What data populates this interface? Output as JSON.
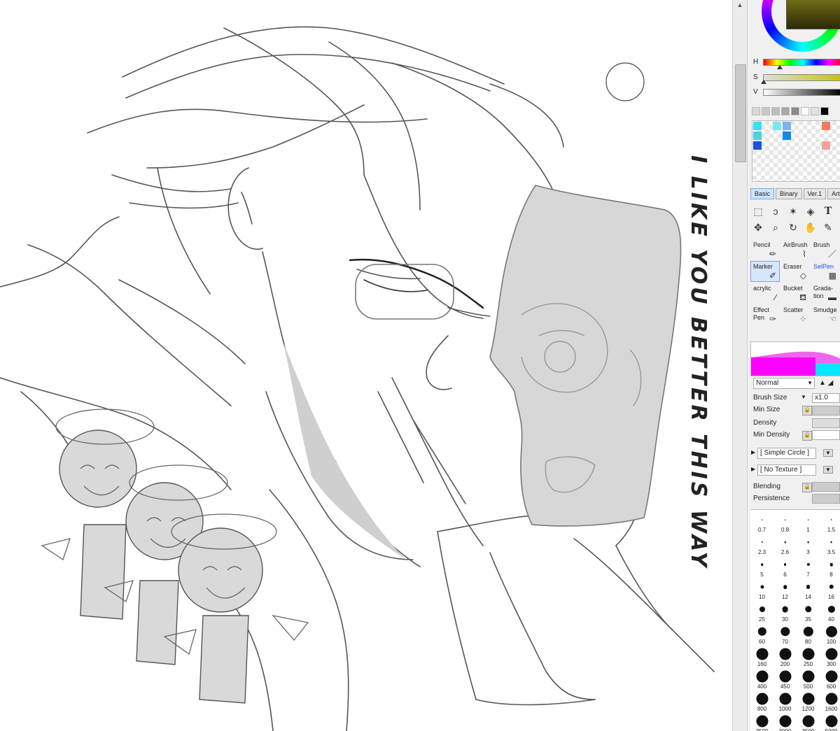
{
  "canvas": {
    "vertical_text": "I LIKE YOU BETTER THIS WAY"
  },
  "panel": {
    "sliders": {
      "h": "H",
      "s": "S",
      "v": "V"
    },
    "tabs": [
      "Basic",
      "Binary",
      "Ver.1",
      "Art"
    ],
    "tools": [
      "select-rect-icon",
      "lasso-icon",
      "magic-wand-icon",
      "layer-select-icon",
      "text-tool-icon",
      "move-icon",
      "zoom-icon",
      "rotate-icon",
      "hand-icon",
      "eyedropper-icon"
    ],
    "brushes": [
      {
        "label": "Pencil",
        "icon": "pencil-icon"
      },
      {
        "label": "AirBrush",
        "icon": "airbrush-icon"
      },
      {
        "label": "Brush",
        "icon": "brush-icon"
      },
      {
        "label": "Marker",
        "icon": "marker-icon",
        "selected": true
      },
      {
        "label": "Eraser",
        "icon": "eraser-icon"
      },
      {
        "label": "SelPen",
        "icon": "selpen-icon"
      },
      {
        "label": "acrylic",
        "icon": "acrylic-icon"
      },
      {
        "label": "Bucket",
        "icon": "bucket-icon"
      },
      {
        "label": "Grada-\ntion",
        "icon": "gradation-icon"
      },
      {
        "label": "Effect\nPen",
        "icon": "effect-pen-icon"
      },
      {
        "label": "Scatter",
        "icon": "scatter-icon"
      },
      {
        "label": "Smudge",
        "icon": "smudge-icon"
      }
    ],
    "blend_mode": "Normal",
    "brush_size_label": "Brush Size",
    "brush_size_value": "x1.0",
    "min_size_label": "Min Size",
    "density_label": "Density",
    "min_density_label": "Min Density",
    "shape": "[ Simple Circle ]",
    "texture": "[ No Texture ]",
    "blending_label": "Blending",
    "persistence_label": "Persistence",
    "sizes": [
      "0.7",
      "0.8",
      "1",
      "1.5",
      "2.3",
      "2.6",
      "3",
      "3.5",
      "5",
      "6",
      "7",
      "8",
      "10",
      "12",
      "14",
      "16",
      "25",
      "30",
      "35",
      "40",
      "60",
      "70",
      "80",
      "100",
      "160",
      "200",
      "250",
      "300",
      "400",
      "450",
      "500",
      "600",
      "800",
      "1000",
      "1200",
      "1600",
      "2500",
      "3000",
      "3500",
      "5000"
    ],
    "colors": {
      "swatch_gray": [
        "#d8d8d8",
        "#c8c8c8",
        "#bdbdbd",
        "#a9a9a9",
        "#8a8a8a",
        "#ffffff",
        "#e2e2e2",
        "#000000"
      ],
      "swatch_color": [
        "#33e3ee",
        "#55cde0",
        "#f07a5e",
        "#7ab4ee",
        "#0f8ae6",
        "#f4a497",
        "#1a4fd8"
      ],
      "magenta": "#ff00ff",
      "cyan": "#00e8ff"
    }
  }
}
